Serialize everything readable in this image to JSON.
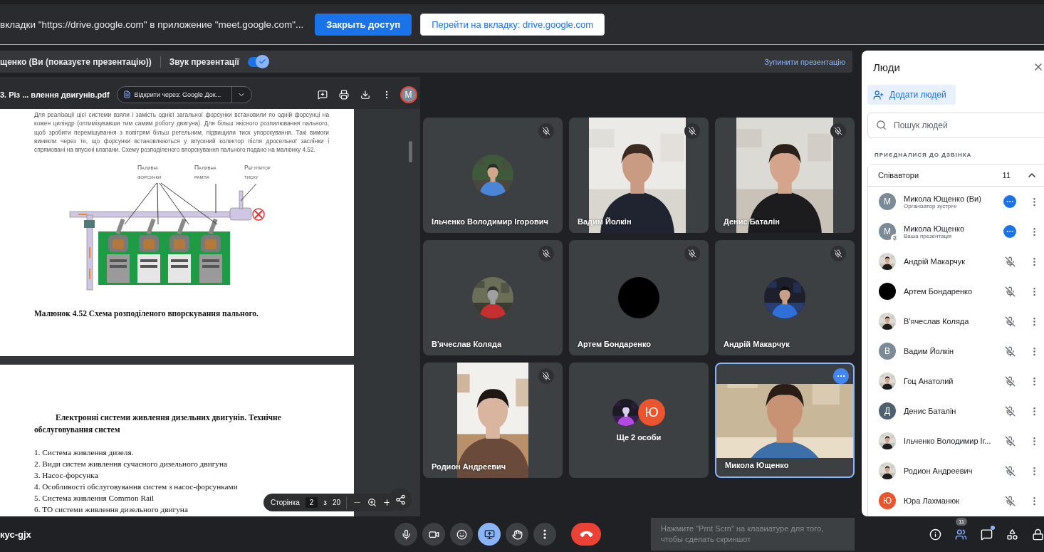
{
  "share_banner": {
    "text": "вкладки \"https://drive.google.com\" в приложение \"meet.google.com\"...",
    "buttons": [
      {
        "label": "Закрыть доступ",
        "kind": "primary"
      },
      {
        "label": "Перейти на вкладку: drive.google.com",
        "kind": "secondary"
      }
    ]
  },
  "presenting_bar": {
    "presenter": "щенко (Ви (показуєте презентацію))",
    "audio_label": "Звук презентації",
    "audio_on": true,
    "stop": "Зупинити презентацію"
  },
  "pdf_viewer": {
    "file_name": "3. Різ ... влення двигунів.pdf",
    "open_with": "Відкрити через: Google Док...",
    "account": "M",
    "page1": {
      "paragraph": "Для реалізації цієї системи взяли і замість однієї загальної форсунки встановили по одній форсунці на кожен циліндр (оптимізувавши тим самим роботу двигуна). Для більш якісного розпилювання пального, щоб зробити перемішування з повітрям більш ретельним, підвищили тиск упорскування. Такі вимоги виникли через те, що форсунки встановлюються у впускний колектор після дросельної заслінки і спрямовані на впускні клапани. Схему розподіленого впорскування пального подано на малюнку 4.52.",
      "figure_labels": [
        [
          "Паливні",
          "форсунки"
        ],
        [
          "Паливна",
          "рампа"
        ],
        [
          "Регулятор",
          "тиску"
        ]
      ],
      "caption": "Малюнок 4.52 Схема розподіленого впорскування пального."
    },
    "page2": {
      "heading": "Електронні системи живлення дизельних двигунів. Технічне обслуговування систем",
      "items": [
        "1. Система живлення дизеля.",
        "2. Види систем живлення  сучасного дизельного двигуна",
        "3. Насос-форсунка",
        "4. Особливості обслуговування систем з насос-форсунками",
        "5. Система живлення Common Rail",
        "6. ТО системи живлення дизельного двигуна"
      ]
    },
    "pager": {
      "label": "Сторінка",
      "page": "2",
      "of": "з",
      "total": "20"
    }
  },
  "tiles": [
    {
      "kind": "avatar",
      "name": "Ільченко Володимир Ігорович",
      "muted": true,
      "selected": false
    },
    {
      "kind": "video-portrait",
      "name": "Вадим Йолкін",
      "muted": true,
      "selected": false
    },
    {
      "kind": "video-portrait",
      "name": "Денис Баталін",
      "muted": true,
      "selected": false
    },
    {
      "kind": "avatar",
      "name": "В'ячеслав Коляда",
      "muted": true,
      "selected": false
    },
    {
      "kind": "blank-avatar",
      "name": "Артем Бондаренко",
      "muted": true,
      "selected": false
    },
    {
      "kind": "avatar",
      "name": "Андрій Макарчук",
      "muted": true,
      "selected": false
    },
    {
      "kind": "video-portrait",
      "name": "Родион Андреевич",
      "muted": true,
      "selected": false
    },
    {
      "kind": "group",
      "name": "Ще 2 особи",
      "muted": false,
      "selected": false,
      "avatars": [
        {
          "kind": "picture"
        },
        {
          "kind": "letter",
          "letter": "Ю",
          "color": "#e8552e"
        }
      ]
    },
    {
      "kind": "video-landscape",
      "name": "Микола Ющенко",
      "muted": false,
      "selected": true
    }
  ],
  "people_panel": {
    "title": "Люди",
    "add_button": "Додати людей",
    "search_placeholder": "Пошук людей",
    "section": "ПРИЄДНАЛИСЯ ДО ДЗВІНКА",
    "group": {
      "label": "Співавтори",
      "count": "11",
      "expanded": true
    },
    "people": [
      {
        "name": "Микола Ющенко (Ви)",
        "role": "Організатор зустрічі",
        "avatar": {
          "kind": "letter",
          "letter": "М",
          "color": "#7b8b97"
        },
        "kind": "dots",
        "presenting": false
      },
      {
        "name": "Микола Ющенко",
        "role": "Ваша презентація",
        "avatar": {
          "kind": "letter",
          "letter": "М",
          "color": "#7b8b97"
        },
        "kind": "dots",
        "presenting": true
      },
      {
        "name": "Андрій Макарчук",
        "avatar": {
          "kind": "picture"
        },
        "kind": "muted",
        "presenting": false
      },
      {
        "name": "Артем Бондаренко",
        "avatar": {
          "kind": "blank"
        },
        "kind": "muted",
        "presenting": false
      },
      {
        "name": "В'ячеслав Коляда",
        "avatar": {
          "kind": "picture"
        },
        "kind": "muted",
        "presenting": false
      },
      {
        "name": "Вадим Йолкін",
        "avatar": {
          "kind": "letter",
          "letter": "В",
          "color": "#7b8b97"
        },
        "kind": "muted",
        "presenting": false
      },
      {
        "name": "Гоц Анатолий",
        "avatar": {
          "kind": "picture"
        },
        "kind": "muted",
        "presenting": false
      },
      {
        "name": "Денис Баталін",
        "avatar": {
          "kind": "letter",
          "letter": "Д",
          "color": "#4e6170"
        },
        "kind": "muted",
        "presenting": false
      },
      {
        "name": "Ільченко Володимир Іг...",
        "avatar": {
          "kind": "picture"
        },
        "kind": "muted",
        "presenting": false
      },
      {
        "name": "Родион Андреевич",
        "avatar": {
          "kind": "picture"
        },
        "kind": "muted",
        "presenting": false
      },
      {
        "name": "Юра Лахманюк",
        "avatar": {
          "kind": "letter",
          "letter": "Ю",
          "color": "#e8552e"
        },
        "kind": "muted",
        "presenting": false
      }
    ]
  },
  "bottom_bar": {
    "meeting_code": "кус-gjx",
    "controls": [
      {
        "kind": "mic",
        "active": false
      },
      {
        "kind": "camera",
        "active": false
      },
      {
        "kind": "emoji",
        "active": false
      },
      {
        "kind": "present",
        "active": true
      },
      {
        "kind": "hand",
        "active": false
      },
      {
        "kind": "more",
        "active": false
      },
      {
        "kind": "hangup",
        "active": false
      }
    ],
    "hint": "Нажмите \"Prnt Scrn\" на клавиатуре для того, чтобы сделать скриншот",
    "side": [
      {
        "kind": "info",
        "active": false
      },
      {
        "kind": "people",
        "active": true,
        "badge": "11"
      },
      {
        "kind": "chat",
        "active": false,
        "dot": true
      },
      {
        "kind": "activities",
        "active": false
      },
      {
        "kind": "lock",
        "active": false
      }
    ]
  }
}
